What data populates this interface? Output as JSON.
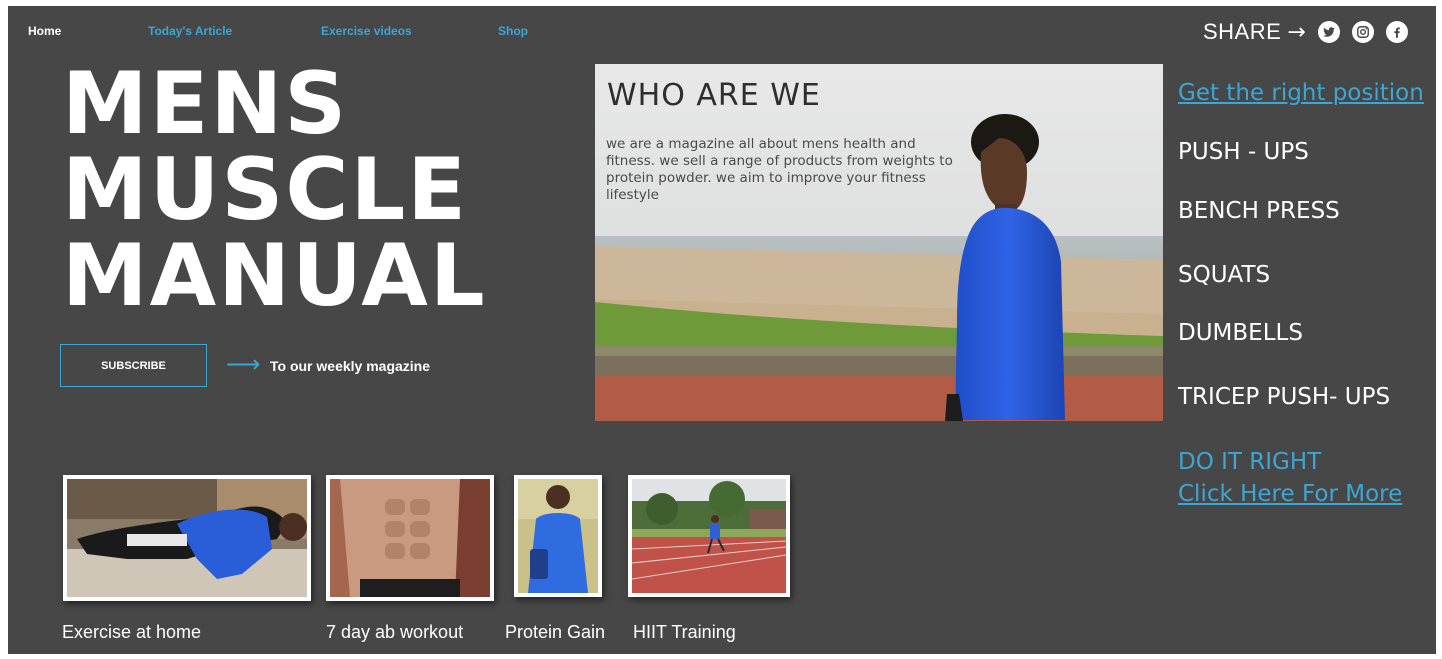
{
  "nav": {
    "home": "Home",
    "article": "Today's Article",
    "videos": "Exercise videos",
    "shop": "Shop"
  },
  "share": {
    "label": "SHARE",
    "arrow": "→",
    "icons": [
      "twitter-icon",
      "instagram-icon",
      "facebook-icon"
    ]
  },
  "title": {
    "line1": "MENS",
    "line2": "MUSCLE",
    "line3": "MANUAL"
  },
  "subscribe": {
    "button": "SUBSCRIBE",
    "arrow": "⟶",
    "text": "To our weekly magazine"
  },
  "hero": {
    "title": "WHO ARE WE",
    "text": "we are a magazine all about mens health and fitness. we sell a range of products from weights to protein powder. we aim to improve your fitness lifestyle"
  },
  "side": {
    "heading_link": "Get the right position",
    "items": [
      "PUSH - UPS",
      "BENCH PRESS",
      "SQUATS",
      "DUMBELLS",
      "TRICEP PUSH- UPS"
    ],
    "do_it_right": "DO IT RIGHT",
    "more_link": "Click Here For More"
  },
  "thumbs": {
    "captions": [
      "Exercise at home",
      "7 day ab workout",
      "Protein Gain",
      "HIIT Training"
    ]
  },
  "colors": {
    "background": "#474747",
    "accent": "#3aa7d6",
    "text": "#ffffff"
  }
}
